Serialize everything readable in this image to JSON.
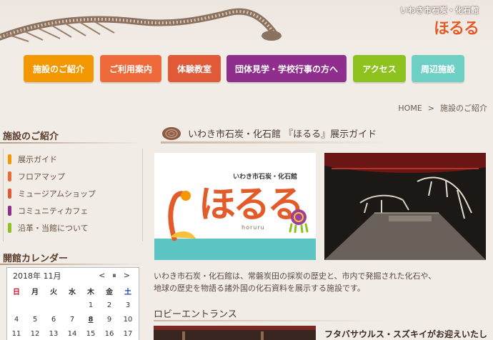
{
  "header": {
    "logo_small": "いわき市石炭・化石館",
    "logo_big": "ほるる"
  },
  "nav": {
    "items": [
      {
        "label": "施設のご紹介",
        "color": "#f39800"
      },
      {
        "label": "ご利用案内",
        "color": "#ee6a3a"
      },
      {
        "label": "体験教室",
        "color": "#e05a38"
      },
      {
        "label": "団体見学・学校行事の方へ",
        "color": "#8f2e8c"
      },
      {
        "label": "アクセス",
        "color": "#8dc21f"
      },
      {
        "label": "周辺施設",
        "color": "#6ecfc4"
      }
    ]
  },
  "breadcrumb": {
    "home": "HOME",
    "separator": ">",
    "current": "施設のご紹介"
  },
  "sidebar": {
    "title": "施設のご紹介",
    "items": [
      {
        "label": "展示ガイド",
        "color": "#f39800"
      },
      {
        "label": "フロアマップ",
        "color": "#ee6a3a"
      },
      {
        "label": "ミュージアムショップ",
        "color": "#e05a38"
      },
      {
        "label": "コミュニティカフェ",
        "color": "#8f2e8c"
      },
      {
        "label": "沿革・当館について",
        "color": "#8dc21f"
      }
    ],
    "calendar_title": "開館カレンダー"
  },
  "calendar": {
    "month_label": "2018年 11月",
    "prev": "<",
    "pause": "⏸",
    "next": ">",
    "weekdays": [
      "日",
      "月",
      "火",
      "水",
      "木",
      "金",
      "土"
    ],
    "rows": [
      [
        "",
        "",
        "",
        "",
        "1",
        "2",
        "3"
      ],
      [
        "4",
        "5",
        "6",
        "7",
        "8",
        "9",
        "10"
      ],
      [
        "11",
        "12",
        "13",
        "14",
        "15",
        "16",
        "17"
      ]
    ]
  },
  "main": {
    "title": "いわき市石炭・化石館 『ほるる』展示ガイド",
    "hero_sub": "いわき市石炭・化石館",
    "hero_big": "ほるる",
    "hero_roman": "horuru",
    "description_line1": "いわき市石炭・化石館は、常磐炭田の採炭の歴史と、市内で発掘された化石や、",
    "description_line2": "地球の歴史を物語る諸外国の化石資料を展示する施設です。",
    "section_title": "ロビーエントランス",
    "lobby_caption": "フタバサウルス・スズキイがお迎えいたし"
  },
  "colors": {
    "background": "#f2ece6",
    "accent": "#e45b2a",
    "teal": "#5dc4c4"
  }
}
